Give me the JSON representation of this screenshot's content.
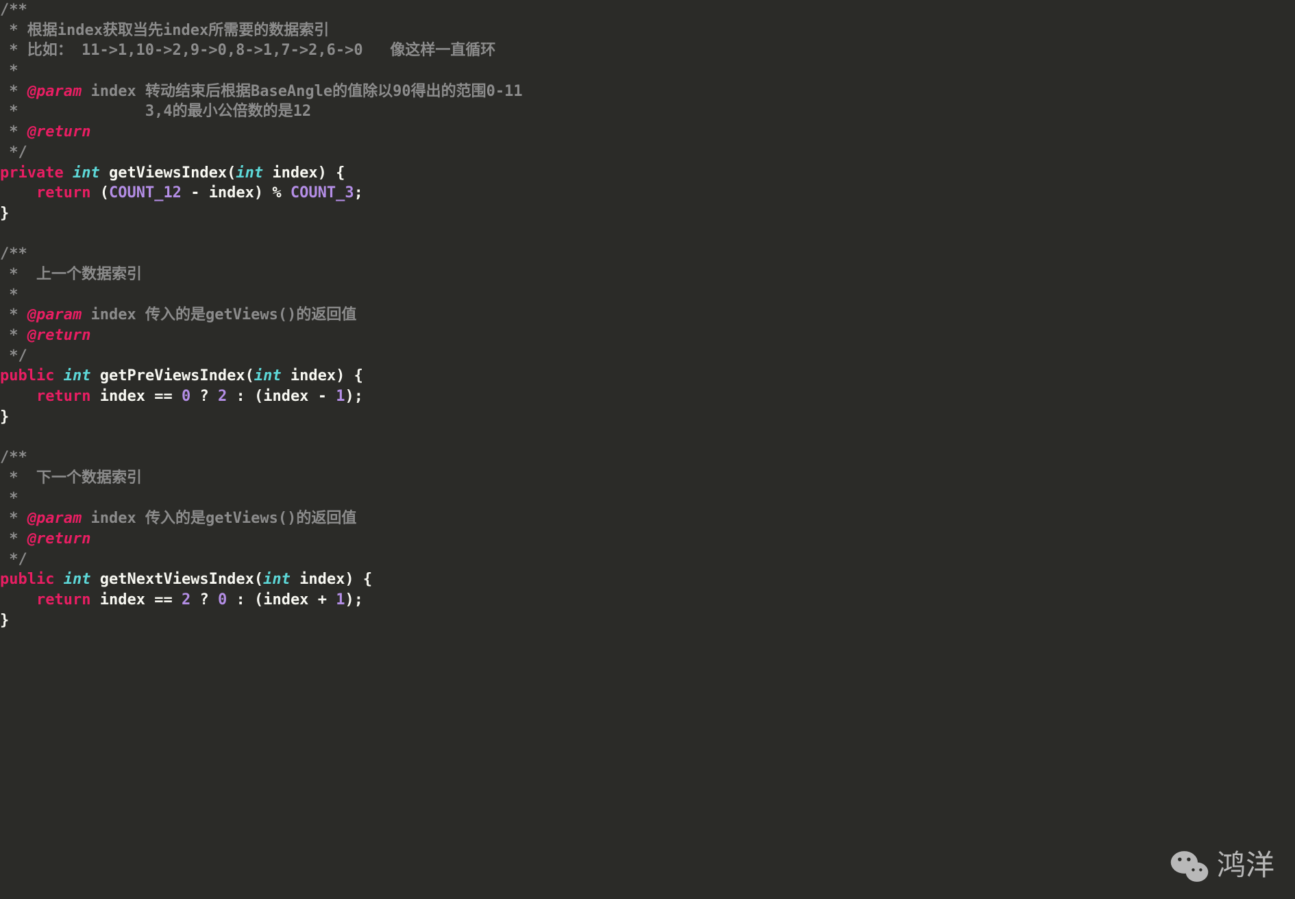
{
  "code": {
    "block1": {
      "doc_open": "/**",
      "line1_pre": " * ",
      "line1": "根据index获取当先index所需要的数据索引",
      "line2_pre": " * ",
      "line2": "比如： 11->1,10->2,9->0,8->1,7->2,6->0   像这样一直循环",
      "line3": " *",
      "line4_pre": " * ",
      "tag_param": "@param",
      "param1_name": " index ",
      "param1_desc": "转动结束后根据BaseAngle的值除以90得出的范围0-11",
      "line5_pre": " *              ",
      "line5": "3,4的最小公倍数的是12",
      "line6_pre": " * ",
      "tag_return": "@return",
      "doc_close": " */",
      "mod": "private",
      "type": "int",
      "method": "getViewsIndex",
      "param_type": "int",
      "param_var": "index",
      "ret_kw": "return",
      "const1": "COUNT_12",
      "ident1": "index",
      "const2": "COUNT_3"
    },
    "block2": {
      "doc_open": "/**",
      "line1_pre": " *  ",
      "line1": "上一个数据索引",
      "line2": " *",
      "line3_pre": " * ",
      "tag_param": "@param",
      "param_name": " index ",
      "param_desc": "传入的是getViews()的返回值",
      "line4_pre": " * ",
      "tag_return": "@return",
      "doc_close": " */",
      "mod": "public",
      "type": "int",
      "method": "getPreViewsIndex",
      "param_type": "int",
      "param_var": "index",
      "ret_kw": "return",
      "ident": "index",
      "n0": "0",
      "n2": "2",
      "n1": "1"
    },
    "block3": {
      "doc_open": "/**",
      "line1_pre": " *  ",
      "line1": "下一个数据索引",
      "line2": " *",
      "line3_pre": " * ",
      "tag_param": "@param",
      "param_name": " index ",
      "param_desc": "传入的是getViews()的返回值",
      "line4_pre": " * ",
      "tag_return": "@return",
      "doc_close": " */",
      "mod": "public",
      "type": "int",
      "method": "getNextViewsIndex",
      "param_type": "int",
      "param_var": "index",
      "ret_kw": "return",
      "ident": "index",
      "n2": "2",
      "n0": "0",
      "n1": "1"
    }
  },
  "watermark": "鸿洋"
}
